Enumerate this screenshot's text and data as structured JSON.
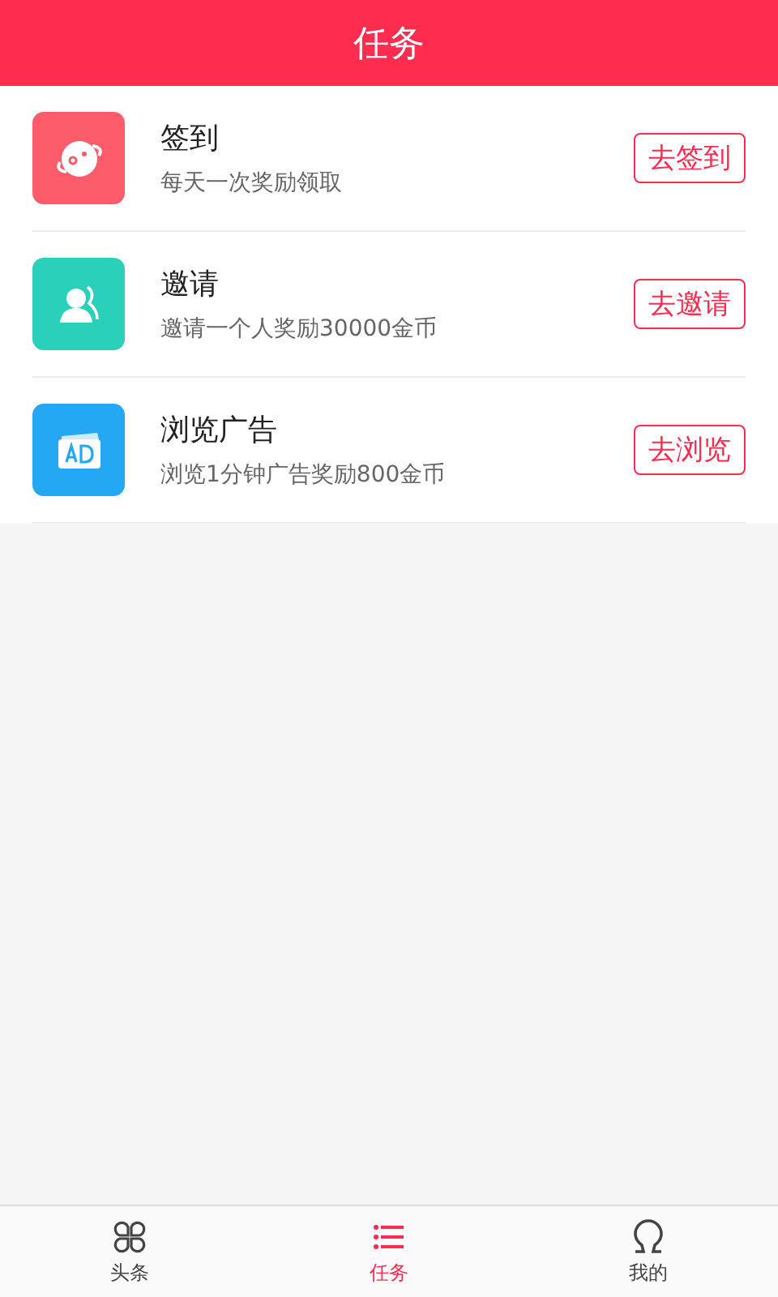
{
  "header": {
    "title": "任务"
  },
  "tasks": [
    {
      "kind": "checkin",
      "title": "签到",
      "desc": "每天一次奖励领取",
      "action": "去签到",
      "color": "#fd5c6a"
    },
    {
      "kind": "invite",
      "title": "邀请",
      "desc": "邀请一个人奖励30000金币",
      "action": "去邀请",
      "color": "#2ad0b9"
    },
    {
      "kind": "ad",
      "title": "浏览广告",
      "desc": "浏览1分钟广告奖励800金币",
      "action": "去浏览",
      "color": "#24a8f3"
    }
  ],
  "tabbar": [
    {
      "kind": "news",
      "label": "头条",
      "selected": false
    },
    {
      "kind": "tasks",
      "label": "任务",
      "selected": true
    },
    {
      "kind": "me",
      "label": "我的",
      "selected": false
    }
  ]
}
